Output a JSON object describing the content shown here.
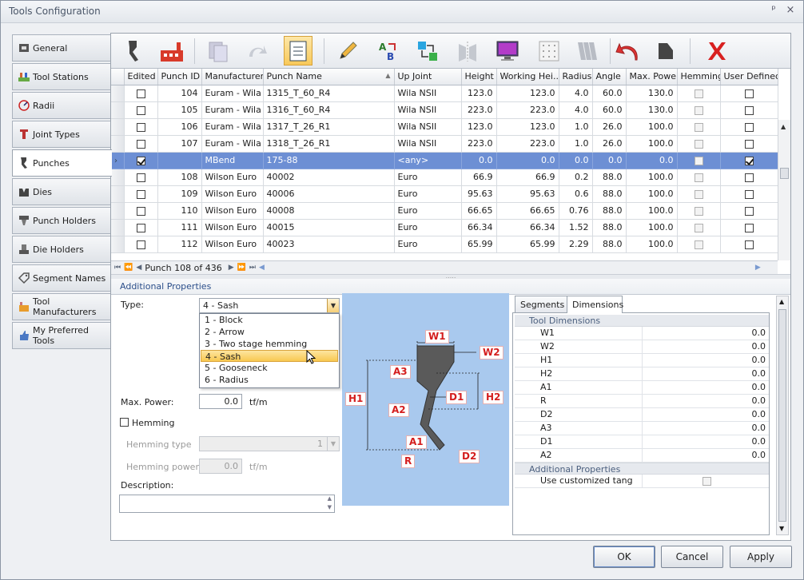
{
  "window": {
    "title": "Tools Configuration",
    "pin_glyph": "ᵖ",
    "close_glyph": "×"
  },
  "nav": [
    {
      "label": "General",
      "icon": "general-icon"
    },
    {
      "label": "Tool Stations",
      "icon": "tool-stations-icon"
    },
    {
      "label": "Radii",
      "icon": "radii-icon"
    },
    {
      "label": "Joint Types",
      "icon": "joint-types-icon"
    },
    {
      "label": "Punches",
      "icon": "punches-icon",
      "selected": true
    },
    {
      "label": "Dies",
      "icon": "dies-icon"
    },
    {
      "label": "Punch Holders",
      "icon": "punch-holders-icon"
    },
    {
      "label": "Die Holders",
      "icon": "die-holders-icon"
    },
    {
      "label": "Segment Names",
      "icon": "segment-names-icon"
    },
    {
      "label": "Tool Manufacturers",
      "icon": "tool-manufacturers-icon"
    },
    {
      "label": "My Preferred Tools",
      "icon": "preferred-tools-icon"
    }
  ],
  "toolbar": [
    "punch-tool-icon",
    "factory-icon",
    "copy-icon",
    "redo-icon",
    "fit-view-icon",
    "pencil-icon",
    "rename-ab-icon",
    "transform-icon",
    "mirror-icon",
    "monitor-icon",
    "grid-icon",
    "multi-tool-icon",
    "undo-arrow-icon",
    "shape-icon",
    "delete-x-icon"
  ],
  "grid": {
    "columns": [
      "Edited",
      "Punch ID",
      "Manufacturer",
      "Punch Name",
      "Up Joint",
      "Height",
      "Working Hei...",
      "Radius",
      "Angle",
      "Max. Power",
      "Hemming",
      "User Defined"
    ],
    "rows": [
      {
        "edited": false,
        "id": "104",
        "mfr": "Euram - Wila",
        "name": "1315_T_60_R4",
        "joint": "Wila NSII",
        "height": "123.0",
        "wh": "123.0",
        "radius": "4.0",
        "angle": "60.0",
        "power": "130.0",
        "hem": false,
        "ud": false
      },
      {
        "edited": false,
        "id": "105",
        "mfr": "Euram - Wila",
        "name": "1316_T_60_R4",
        "joint": "Wila NSII",
        "height": "223.0",
        "wh": "223.0",
        "radius": "4.0",
        "angle": "60.0",
        "power": "130.0",
        "hem": false,
        "ud": false
      },
      {
        "edited": false,
        "id": "106",
        "mfr": "Euram - Wila",
        "name": "1317_T_26_R1",
        "joint": "Wila NSII",
        "height": "123.0",
        "wh": "123.0",
        "radius": "1.0",
        "angle": "26.0",
        "power": "100.0",
        "hem": false,
        "ud": false
      },
      {
        "edited": false,
        "id": "107",
        "mfr": "Euram - Wila",
        "name": "1318_T_26_R1",
        "joint": "Wila NSII",
        "height": "223.0",
        "wh": "223.0",
        "radius": "1.0",
        "angle": "26.0",
        "power": "100.0",
        "hem": false,
        "ud": false
      },
      {
        "edited": true,
        "id": "",
        "mfr": "MBend",
        "name": "175-88",
        "joint": "<any>",
        "height": "0.0",
        "wh": "0.0",
        "radius": "0.0",
        "angle": "0.0",
        "power": "0.0",
        "hem": false,
        "ud": true,
        "selected": true
      },
      {
        "edited": false,
        "id": "108",
        "mfr": "Wilson Euro",
        "name": "40002",
        "joint": "Euro",
        "height": "66.9",
        "wh": "66.9",
        "radius": "0.2",
        "angle": "88.0",
        "power": "100.0",
        "hem": false,
        "ud": false
      },
      {
        "edited": false,
        "id": "109",
        "mfr": "Wilson Euro",
        "name": "40006",
        "joint": "Euro",
        "height": "95.63",
        "wh": "95.63",
        "radius": "0.6",
        "angle": "88.0",
        "power": "100.0",
        "hem": false,
        "ud": false
      },
      {
        "edited": false,
        "id": "110",
        "mfr": "Wilson Euro",
        "name": "40008",
        "joint": "Euro",
        "height": "66.65",
        "wh": "66.65",
        "radius": "0.76",
        "angle": "88.0",
        "power": "100.0",
        "hem": false,
        "ud": false
      },
      {
        "edited": false,
        "id": "111",
        "mfr": "Wilson Euro",
        "name": "40015",
        "joint": "Euro",
        "height": "66.34",
        "wh": "66.34",
        "radius": "1.52",
        "angle": "88.0",
        "power": "100.0",
        "hem": false,
        "ud": false
      },
      {
        "edited": false,
        "id": "112",
        "mfr": "Wilson Euro",
        "name": "40023",
        "joint": "Euro",
        "height": "65.99",
        "wh": "65.99",
        "radius": "2.29",
        "angle": "88.0",
        "power": "100.0",
        "hem": false,
        "ud": false
      }
    ],
    "record_nav": "Punch 108 of 436"
  },
  "additional": {
    "header": "Additional Properties",
    "type_label": "Type:",
    "type_value": "4 - Sash",
    "type_options": [
      "1 - Block",
      "2 - Arrow",
      "3 - Two stage hemming",
      "4 - Sash",
      "5 - Gooseneck",
      "6 - Radius"
    ],
    "max_power_label": "Max. Power:",
    "max_power_value": "0.0",
    "power_unit": "tf/m",
    "hemming_label": "Hemming",
    "hemming_type_label": "Hemming type",
    "hemming_type_value": "1",
    "hemming_power_label": "Hemming power:",
    "hemming_power_value": "0.0",
    "hemming_power_unit": "tf/m",
    "description_label": "Description:"
  },
  "diagram": {
    "labels": [
      "W1",
      "W2",
      "A3",
      "H1",
      "D1",
      "H2",
      "A2",
      "A1",
      "R",
      "D2"
    ]
  },
  "tabs": {
    "segments": "Segments",
    "dimensions": "Dimensions"
  },
  "dimensions": {
    "category": "Tool Dimensions",
    "rows": [
      {
        "k": "W1",
        "v": "0.0"
      },
      {
        "k": "W2",
        "v": "0.0"
      },
      {
        "k": "H1",
        "v": "0.0"
      },
      {
        "k": "H2",
        "v": "0.0"
      },
      {
        "k": "A1",
        "v": "0.0"
      },
      {
        "k": "R",
        "v": "0.0"
      },
      {
        "k": "D2",
        "v": "0.0"
      },
      {
        "k": "A3",
        "v": "0.0"
      },
      {
        "k": "D1",
        "v": "0.0"
      },
      {
        "k": "A2",
        "v": "0.0"
      }
    ],
    "add_category": "Additional Properties",
    "custom_tang_label": "Use customized tang"
  },
  "buttons": {
    "ok": "OK",
    "cancel": "Cancel",
    "apply": "Apply"
  }
}
